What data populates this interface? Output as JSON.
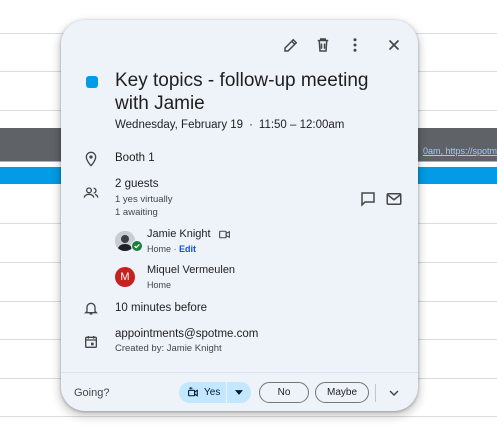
{
  "background": {
    "banner_text": "0am, https://spotm"
  },
  "toolbar": {
    "edit_icon": "pencil-icon",
    "delete_icon": "trash-icon",
    "more_icon": "more-vert-icon",
    "close_icon": "close-icon"
  },
  "event": {
    "color": "#039be5",
    "title": "Key topics - follow-up meeting with Jamie",
    "date": "Wednesday, February 19",
    "separator": "·",
    "time": "11:50 – 12:00am",
    "location": "Booth 1"
  },
  "guests": {
    "count_label": "2 guests",
    "yes_summary": "1 yes virtually",
    "awaiting_summary": "1 awaiting",
    "list": [
      {
        "name": "Jamie Knight",
        "location": "Home",
        "action": "Edit",
        "avatar": "photo"
      },
      {
        "name": "Miquel Vermeulen",
        "location": "Home",
        "initial": "M",
        "avatar_color": "#c5221f"
      }
    ]
  },
  "reminder": "10 minutes before",
  "calendar": {
    "name": "appointments@spotme.com",
    "created_by": "Created by: Jamie Knight"
  },
  "rsvp": {
    "prompt": "Going?",
    "yes": "Yes",
    "no": "No",
    "maybe": "Maybe"
  },
  "colors": {
    "accent": "#0b57d0",
    "card_bg": "#eef2f9",
    "yes_bg": "#c2e7ff"
  }
}
